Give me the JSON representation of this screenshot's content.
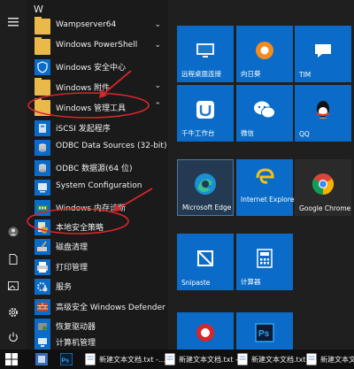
{
  "start_menu": {
    "letter_header": "W",
    "apps": [
      {
        "label": "Wampserver64",
        "icon": "folder-icon"
      },
      {
        "label": "Windows PowerShell",
        "icon": "folder-icon"
      },
      {
        "label": "Windows 安全中心",
        "icon": "shield-icon"
      },
      {
        "label": "Windows 附件",
        "icon": "folder-icon"
      },
      {
        "label": "Windows 管理工具",
        "icon": "folder-icon",
        "expanded": true
      },
      {
        "label": "iSCSI 发起程序",
        "icon": "iscsi-icon"
      },
      {
        "label": "ODBC Data Sources (32-bit)",
        "icon": "odbc-icon"
      },
      {
        "label": "ODBC 数据源(64 位)",
        "icon": "odbc-icon"
      },
      {
        "label": "System Configuration",
        "icon": "sysconfig-icon"
      },
      {
        "label": "Windows 内存诊断",
        "icon": "memory-icon"
      },
      {
        "label": "本地安全策略",
        "icon": "security-policy-icon"
      },
      {
        "label": "磁盘清理",
        "icon": "disk-cleanup-icon"
      },
      {
        "label": "打印管理",
        "icon": "print-icon"
      },
      {
        "label": "服务",
        "icon": "services-icon"
      },
      {
        "label": "高级安全 Windows Defender 防火墙",
        "icon": "firewall-icon"
      },
      {
        "label": "恢复驱动器",
        "icon": "recovery-icon"
      },
      {
        "label": "计算机管理",
        "icon": "computer-management-icon"
      }
    ]
  },
  "tiles": [
    {
      "label": "远程桌面连接",
      "icon": "remote-desktop-icon"
    },
    {
      "label": "向日葵",
      "icon": "sunflower-icon"
    },
    {
      "label": "TIM",
      "icon": "tim-icon"
    },
    {
      "label": "千牛工作台",
      "icon": "qianniu-icon"
    },
    {
      "label": "微信",
      "icon": "wechat-icon"
    },
    {
      "label": "QQ",
      "icon": "qq-icon"
    },
    {
      "label": "Microsoft Edge",
      "icon": "edge-icon"
    },
    {
      "label": "Internet Explorer",
      "icon": "ie-icon"
    },
    {
      "label": "Google Chrome",
      "icon": "chrome-icon"
    },
    {
      "label": "Snipaste",
      "icon": "snipaste-icon"
    },
    {
      "label": "计算器",
      "icon": "calculator-icon"
    },
    {
      "label": "",
      "icon": "red-app-icon"
    },
    {
      "label": "",
      "icon": "photoshop-icon"
    }
  ],
  "taskbar": {
    "windows": [
      {
        "label": "新建文本文档.txt -..."
      },
      {
        "label": "新建文本文档.txt -..."
      },
      {
        "label": "新建文本文档.txt -..."
      },
      {
        "label": "新建文本文..."
      }
    ]
  },
  "colors": {
    "tile_blue": "#0a6cc8",
    "annotation_red": "#d8262a",
    "folder_yellow": "#e9b949"
  }
}
